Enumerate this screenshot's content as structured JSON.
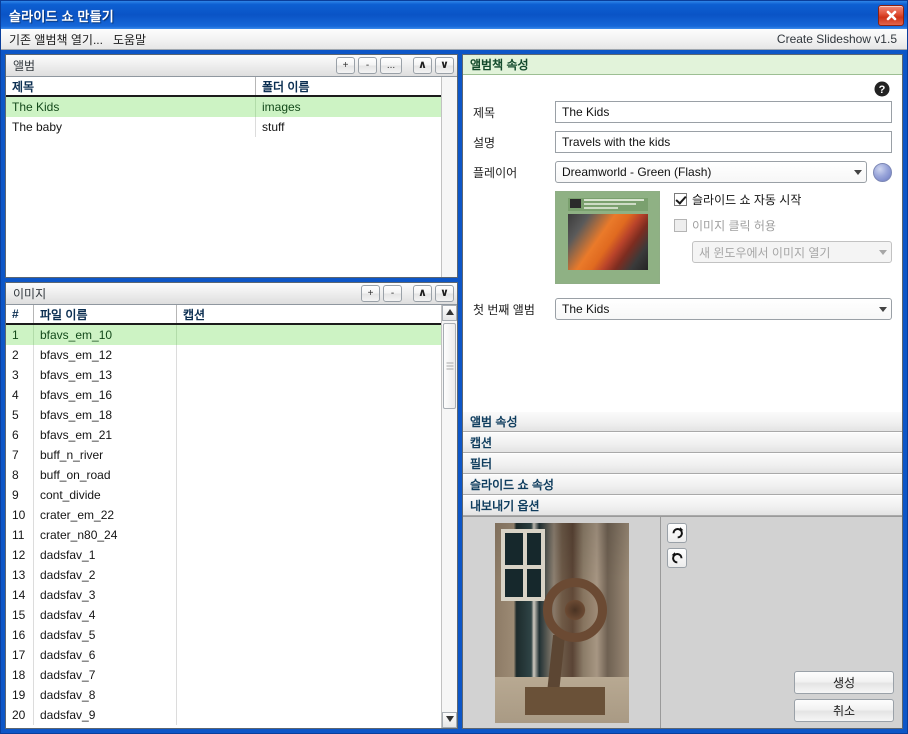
{
  "window": {
    "title": "슬라이드 쇼 만들기",
    "close_icon": "close-icon"
  },
  "menubar": {
    "items": [
      {
        "label": "기존 앨범책 열기..."
      },
      {
        "label": "도움말"
      }
    ],
    "app_version": "Create Slideshow v1.5"
  },
  "album_panel": {
    "title": "앨범",
    "buttons": [
      {
        "name": "add",
        "label": "+"
      },
      {
        "name": "remove",
        "label": "-"
      },
      {
        "name": "more",
        "label": "..."
      },
      {
        "name": "move-up",
        "label": "∧"
      },
      {
        "name": "move-down",
        "label": "∨"
      }
    ],
    "columns": [
      "제목",
      "폴더 이름"
    ],
    "rows": [
      {
        "title": "The Kids",
        "folder": "images",
        "selected": true
      },
      {
        "title": "The baby",
        "folder": "stuff",
        "selected": false
      }
    ]
  },
  "images_panel": {
    "title": "이미지",
    "buttons": [
      {
        "name": "add",
        "label": "+"
      },
      {
        "name": "remove",
        "label": "-"
      },
      {
        "name": "move-up",
        "label": "∧"
      },
      {
        "name": "move-down",
        "label": "∨"
      }
    ],
    "columns": [
      "#",
      "파일 이름",
      "캡션"
    ],
    "rows": [
      {
        "num": "1",
        "file": "bfavs_em_10",
        "caption": "",
        "selected": true
      },
      {
        "num": "2",
        "file": "bfavs_em_12",
        "caption": "",
        "selected": false
      },
      {
        "num": "3",
        "file": "bfavs_em_13",
        "caption": "",
        "selected": false
      },
      {
        "num": "4",
        "file": "bfavs_em_16",
        "caption": "",
        "selected": false
      },
      {
        "num": "5",
        "file": "bfavs_em_18",
        "caption": "",
        "selected": false
      },
      {
        "num": "6",
        "file": "bfavs_em_21",
        "caption": "",
        "selected": false
      },
      {
        "num": "7",
        "file": "buff_n_river",
        "caption": "",
        "selected": false
      },
      {
        "num": "8",
        "file": "buff_on_road",
        "caption": "",
        "selected": false
      },
      {
        "num": "9",
        "file": "cont_divide",
        "caption": "",
        "selected": false
      },
      {
        "num": "10",
        "file": "crater_em_22",
        "caption": "",
        "selected": false
      },
      {
        "num": "11",
        "file": "crater_n80_24",
        "caption": "",
        "selected": false
      },
      {
        "num": "12",
        "file": "dadsfav_1",
        "caption": "",
        "selected": false
      },
      {
        "num": "13",
        "file": "dadsfav_2",
        "caption": "",
        "selected": false
      },
      {
        "num": "14",
        "file": "dadsfav_3",
        "caption": "",
        "selected": false
      },
      {
        "num": "15",
        "file": "dadsfav_4",
        "caption": "",
        "selected": false
      },
      {
        "num": "16",
        "file": "dadsfav_5",
        "caption": "",
        "selected": false
      },
      {
        "num": "17",
        "file": "dadsfav_6",
        "caption": "",
        "selected": false
      },
      {
        "num": "18",
        "file": "dadsfav_7",
        "caption": "",
        "selected": false
      },
      {
        "num": "19",
        "file": "dadsfav_8",
        "caption": "",
        "selected": false
      },
      {
        "num": "20",
        "file": "dadsfav_9",
        "caption": "",
        "selected": false
      }
    ]
  },
  "properties": {
    "active_section": "앨범책 속성",
    "help_icon": "help-icon",
    "title_label": "제목",
    "title_value": "The Kids",
    "desc_label": "설명",
    "desc_value": "Travels with the kids",
    "player_label": "플레이어",
    "player_value": "Dreamworld - Green (Flash)",
    "autostart_label": "슬라이드 쇼 자동 시작",
    "autostart_checked": true,
    "clickable_label": "이미지 클릭 허용",
    "clickable_checked": false,
    "click_action_value": "새 윈도우에서 이미지 열기",
    "first_album_label": "첫 번째 앨범",
    "first_album_value": "The Kids",
    "sections": [
      {
        "label": "앨범 속성"
      },
      {
        "label": "캡션"
      },
      {
        "label": "필터"
      },
      {
        "label": "슬라이드 쇼 속성"
      },
      {
        "label": "내보내기 옵션"
      }
    ]
  },
  "preview": {
    "rotate_cw_icon": "rotate-clockwise-icon",
    "rotate_ccw_icon": "rotate-counterclockwise-icon"
  },
  "footer": {
    "create_label": "생성",
    "cancel_label": "취소"
  },
  "colors": {
    "titlebar_blue": "#0a54c6",
    "selection_green": "#cdf3c4",
    "section_active_bg": "#e2f3da",
    "close_red": "#cf3318"
  }
}
